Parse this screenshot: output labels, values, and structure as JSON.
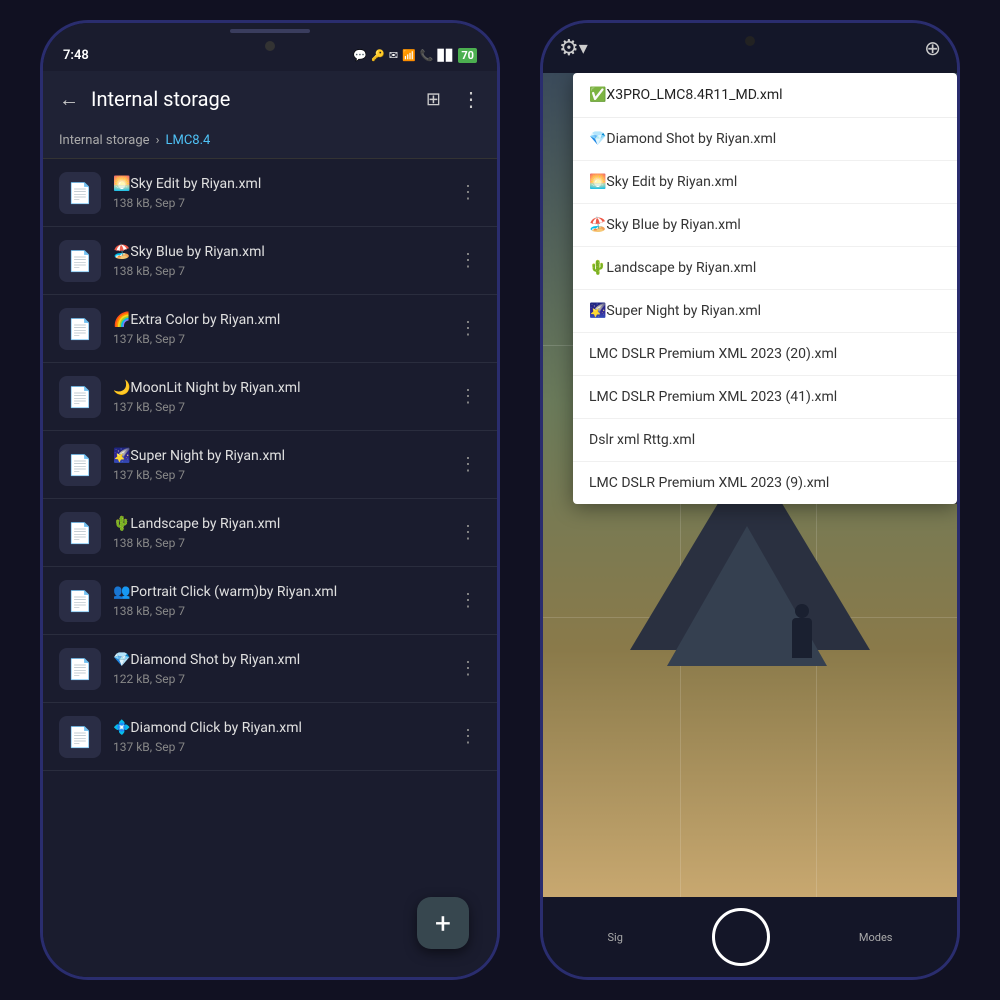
{
  "left_phone": {
    "status": {
      "time": "7:48",
      "icons": "📱✉",
      "wifi": "WiFi",
      "signal": "Signal",
      "battery": "70"
    },
    "header": {
      "title": "Internal storage",
      "back_icon": "←",
      "grid_icon": "⊞",
      "more_icon": "⋮"
    },
    "breadcrumb": {
      "root": "Internal storage",
      "separator": "›",
      "current": "LMC8.4"
    },
    "files": [
      {
        "name": "🌅Sky Edit by Riyan.xml",
        "meta": "138 kB, Sep 7"
      },
      {
        "name": "🏖️Sky Blue by Riyan.xml",
        "meta": "138 kB, Sep 7"
      },
      {
        "name": "🌈Extra Color by Riyan.xml",
        "meta": "137 kB, Sep 7"
      },
      {
        "name": "🌙MoonLit Night by Riyan.xml",
        "meta": "137 kB, Sep 7"
      },
      {
        "name": "🌠Super Night by Riyan.xml",
        "meta": "137 kB, Sep 7"
      },
      {
        "name": "🌵Landscape by Riyan.xml",
        "meta": "138 kB, Sep 7"
      },
      {
        "name": "👥Portrait Click (warm)by Riyan.xml",
        "meta": "138 kB, Sep 7"
      },
      {
        "name": "💎Diamond Shot by Riyan.xml",
        "meta": "122 kB, Sep 7"
      },
      {
        "name": "💠Diamond Click by Riyan.xml",
        "meta": "137 kB, Sep 7"
      }
    ],
    "fab": "+"
  },
  "right_phone": {
    "cam_icons": {
      "settings": "⚙",
      "dropdown": "▾",
      "more": "⊕"
    },
    "dropdown": {
      "header": "✅X3PRO_LMC8.4R11_MD.xml",
      "items": [
        "💎Diamond Shot by Riyan.xml",
        "🌅Sky Edit by Riyan.xml",
        "🏖️Sky Blue by Riyan.xml",
        "🌵Landscape by Riyan.xml",
        "🌠Super Night by Riyan.xml",
        "LMC DSLR Premium XML 2023 (20).xml",
        "LMC DSLR Premium XML 2023 (41).xml",
        "Dslr xml Rttg.xml",
        "LMC DSLR Premium XML 2023 (9).xml"
      ]
    },
    "bottom": {
      "sig": "Sig",
      "modes": "Modes"
    }
  }
}
